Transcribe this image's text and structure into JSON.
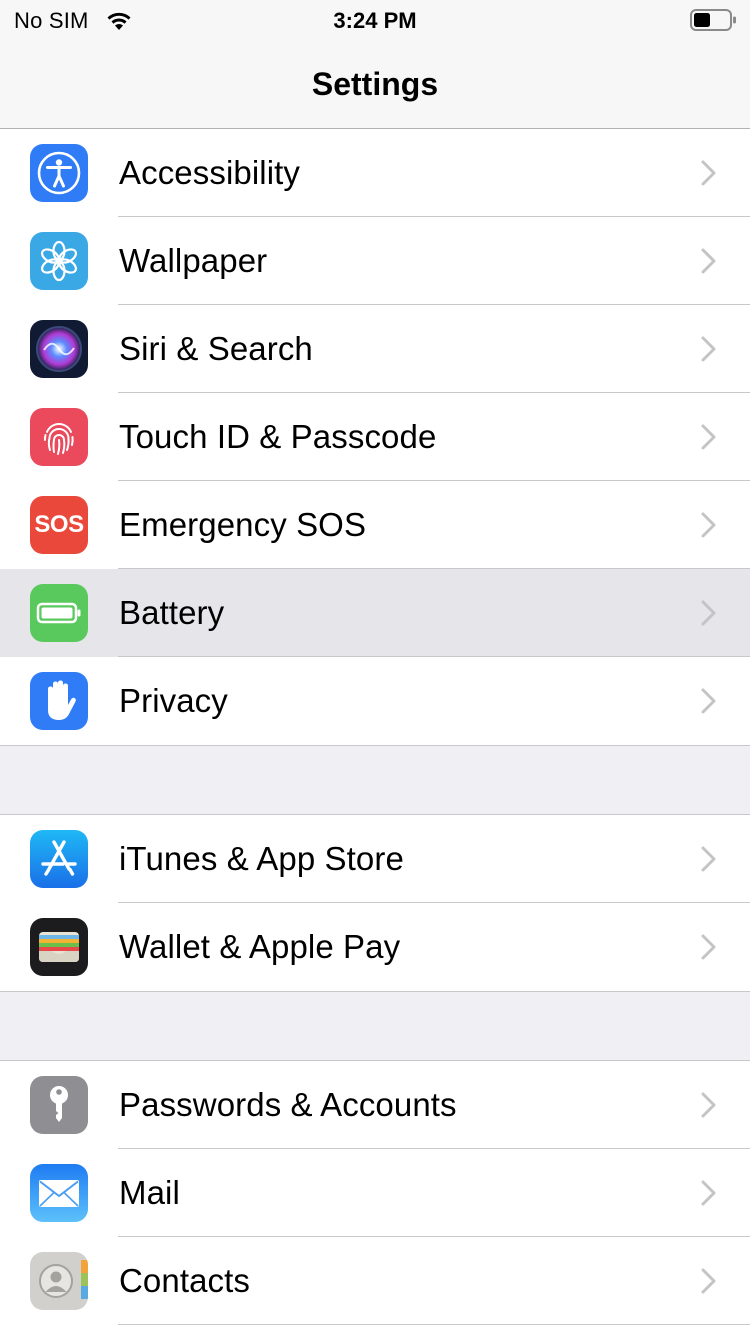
{
  "status": {
    "carrier": "No SIM",
    "time": "3:24 PM"
  },
  "nav": {
    "title": "Settings"
  },
  "groups": [
    {
      "items": [
        {
          "label": "Accessibility",
          "icon": "accessibility-icon",
          "color": "#2f7cf6"
        },
        {
          "label": "Wallpaper",
          "icon": "wallpaper-icon",
          "color": "#3ba8e6"
        },
        {
          "label": "Siri & Search",
          "icon": "siri-icon",
          "color": "#111a33"
        },
        {
          "label": "Touch ID & Passcode",
          "icon": "fingerprint-icon",
          "color": "#ea4a5c"
        },
        {
          "label": "Emergency SOS",
          "icon": "sos-icon",
          "color": "#e9483b",
          "icon_text": "SOS"
        },
        {
          "label": "Battery",
          "icon": "battery-icon",
          "color": "#5ac95d"
        },
        {
          "label": "Privacy",
          "icon": "hand-icon",
          "color": "#2f7cf6"
        }
      ]
    },
    {
      "items": [
        {
          "label": "iTunes & App Store",
          "icon": "app-store-icon",
          "color": "#2d8cf0"
        },
        {
          "label": "Wallet & Apple Pay",
          "icon": "wallet-icon",
          "color": "#1c1c1e"
        }
      ]
    },
    {
      "items": [
        {
          "label": "Passwords & Accounts",
          "icon": "key-icon",
          "color": "#8e8e93"
        },
        {
          "label": "Mail",
          "icon": "mail-icon",
          "color": "#2f8ef5"
        },
        {
          "label": "Contacts",
          "icon": "contacts-icon",
          "color": "#c9c9c6"
        }
      ]
    }
  ]
}
